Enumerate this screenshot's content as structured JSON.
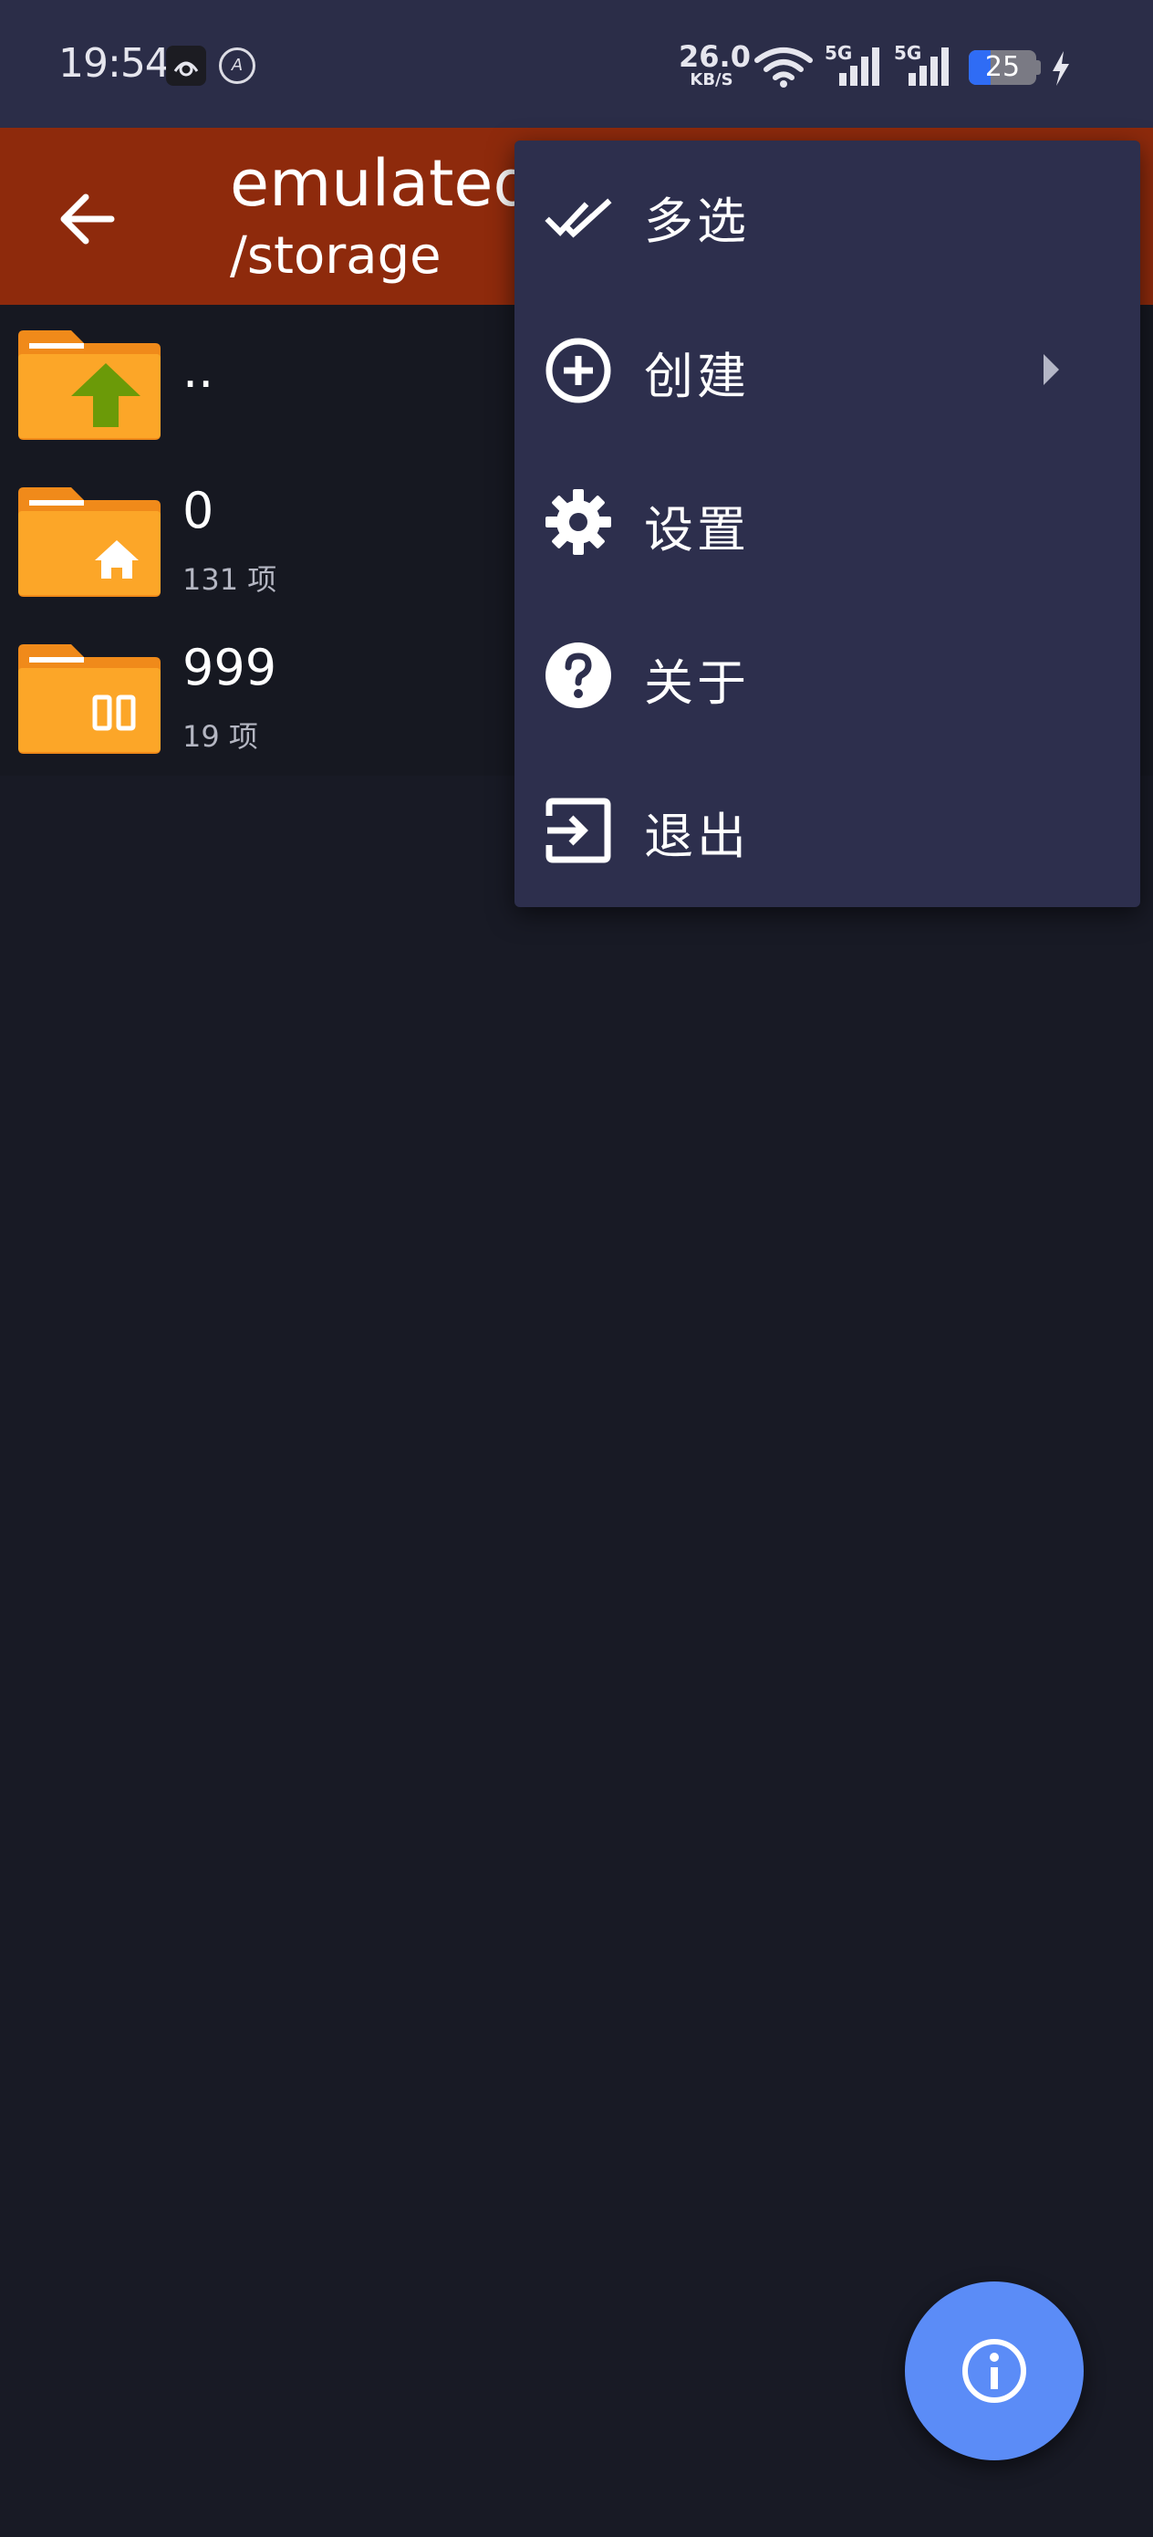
{
  "status_bar": {
    "time": "19:54",
    "ad_badge": "A",
    "net_speed_value": "26.0",
    "net_speed_unit": "KB/S",
    "sim1_label": "5G",
    "sim2_label": "5G",
    "battery_level": "25",
    "battery_fraction": 0.33
  },
  "app_bar": {
    "title": "emulated",
    "subtitle": "/storage",
    "accent_color": "#8e2a0c"
  },
  "files": [
    {
      "name": "..",
      "meta": "",
      "icon": "parent-folder-icon"
    },
    {
      "name": "0",
      "meta": "131 项",
      "icon": "home-folder-icon"
    },
    {
      "name": "999",
      "meta": "19 项",
      "icon": "dual-app-folder-icon"
    }
  ],
  "menu": {
    "items": [
      {
        "label": "多选",
        "icon": "double-check-icon"
      },
      {
        "label": "创建",
        "icon": "add-circle-icon",
        "has_submenu": true
      },
      {
        "label": "设置",
        "icon": "gear-icon"
      },
      {
        "label": "关于",
        "icon": "help-circle-icon"
      },
      {
        "label": "退出",
        "icon": "exit-icon"
      }
    ]
  },
  "fab": {
    "icon": "info-icon",
    "color": "#5b8cf7"
  }
}
